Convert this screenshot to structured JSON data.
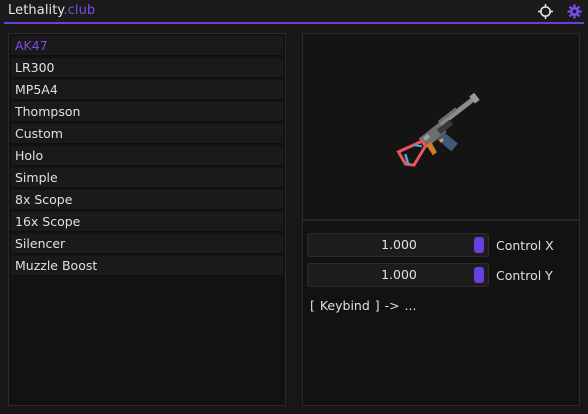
{
  "window": {
    "title_main": "Lethality",
    "title_suffix": ".club",
    "accent_color": "#7a4ee8"
  },
  "header_icons": [
    "crosshair-icon",
    "gear-icon"
  ],
  "weapon_list": [
    {
      "label": "AK47",
      "active": true
    },
    {
      "label": "LR300",
      "active": false
    },
    {
      "label": "MP5A4",
      "active": false
    },
    {
      "label": "Thompson",
      "active": false
    },
    {
      "label": "Custom",
      "active": false
    },
    {
      "label": "Holo",
      "active": false
    },
    {
      "label": "Simple",
      "active": false
    },
    {
      "label": "8x Scope",
      "active": false
    },
    {
      "label": "16x Scope",
      "active": false
    },
    {
      "label": "Silencer",
      "active": false
    },
    {
      "label": "Muzzle Boost",
      "active": false
    }
  ],
  "preview": {
    "icon": "ak47-rifle-icon"
  },
  "controls": {
    "control_x": {
      "value": "1.000",
      "label": "Control X"
    },
    "control_y": {
      "value": "1.000",
      "label": "Control Y"
    },
    "keybind": "[ Keybind ] ->   ..."
  }
}
